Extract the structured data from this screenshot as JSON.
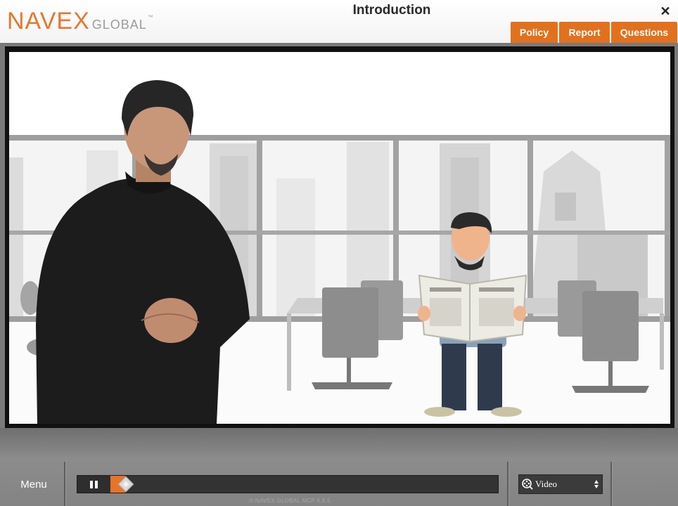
{
  "header": {
    "logo_main": "NAVEX",
    "logo_sub": "GLOBAL",
    "logo_tm": "™",
    "title": "Introduction",
    "close_symbol": "✕"
  },
  "tabs": [
    {
      "label": "Policy"
    },
    {
      "label": "Report"
    },
    {
      "label": "Questions"
    }
  ],
  "player": {
    "menu_label": "Menu",
    "progress": 0.05,
    "playing": true,
    "view_select": {
      "selected": "Video",
      "options_visible": [
        "Video"
      ]
    },
    "footer": "© NAVEX GLOBAL MCP 6.8.5"
  },
  "colors": {
    "brand_orange": "#e2711d",
    "logo_orange": "#e5782e",
    "control_bar": "#7f7f7f"
  },
  "icons": [
    "close-icon",
    "pause-icon",
    "seek-handle-icon",
    "video-icon",
    "select-arrows-icon"
  ]
}
